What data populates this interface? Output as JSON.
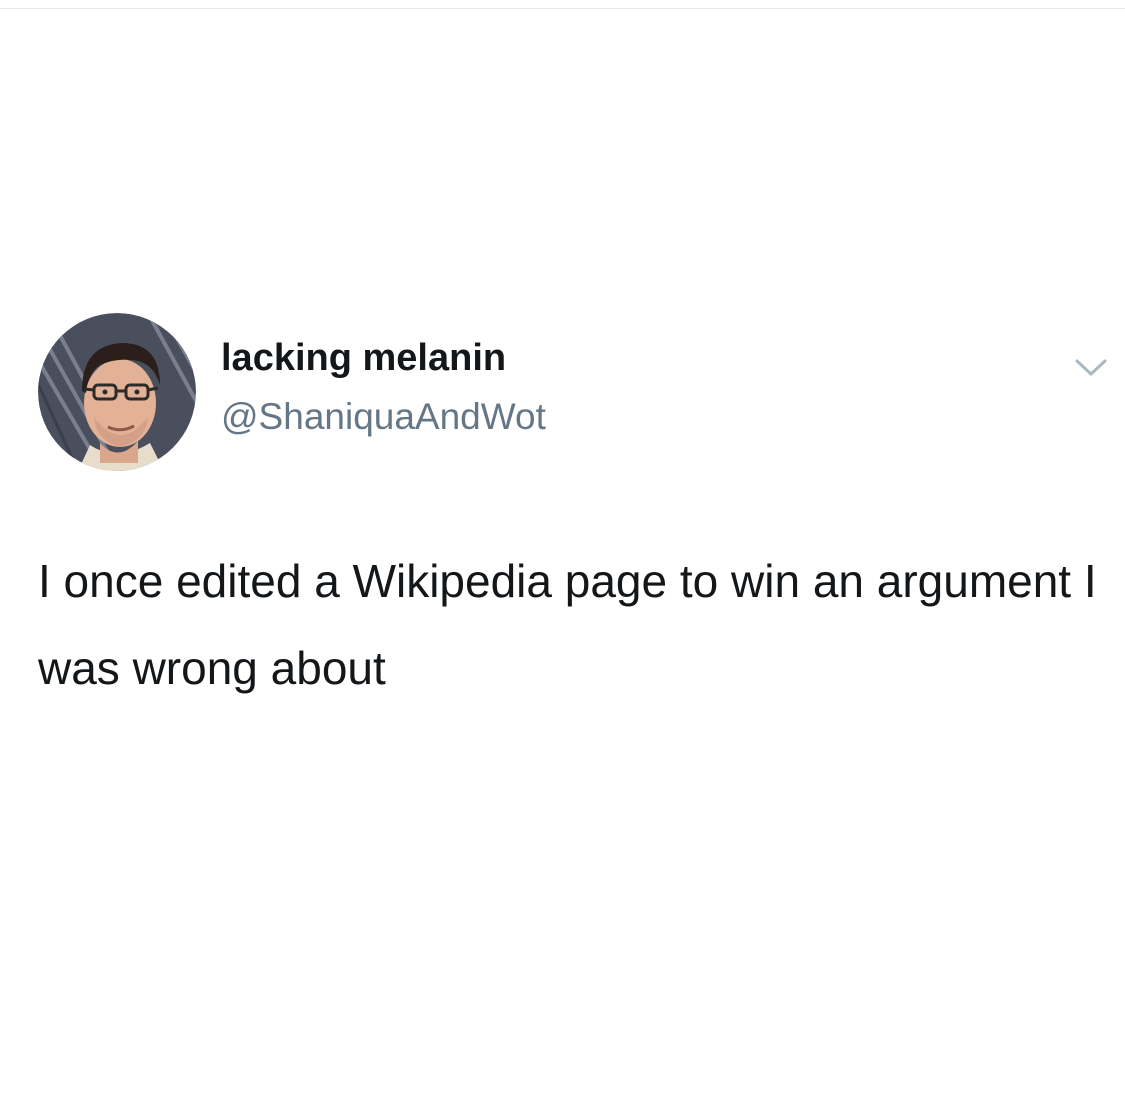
{
  "tweet": {
    "display_name": "lacking melanin",
    "handle": "@ShaniquaAndWot",
    "text": "I once edited a Wikipedia page to win an argument I was wrong about",
    "avatar_icon": "profile-photo",
    "menu_icon": "chevron-down-icon"
  },
  "colors": {
    "background": "#ffffff",
    "name": "#14171a",
    "handle": "#657786",
    "chevron": "#aab8c2"
  }
}
